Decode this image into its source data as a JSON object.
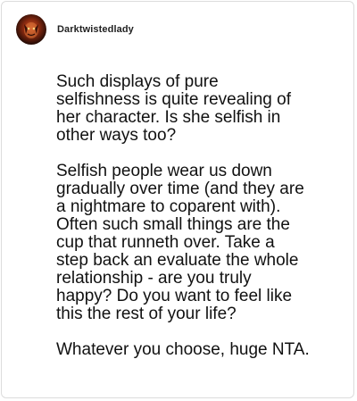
{
  "post": {
    "username": "Darktwistedlady",
    "avatar_icon": "avatar-image",
    "paragraphs": [
      "Such displays of pure\nselfishness is quite revealing of\nher character. Is she selfish in\nother ways too?",
      "Selfish people wear us down\ngradually over time (and they are\na nightmare to coparent with).\nOften such small things are the\ncup that runneth over. Take a\nstep back an evaluate the whole\nrelationship - are you truly\nhappy? Do you want to feel like\nthis the rest of your life?",
      "Whatever you choose, huge NTA."
    ]
  }
}
